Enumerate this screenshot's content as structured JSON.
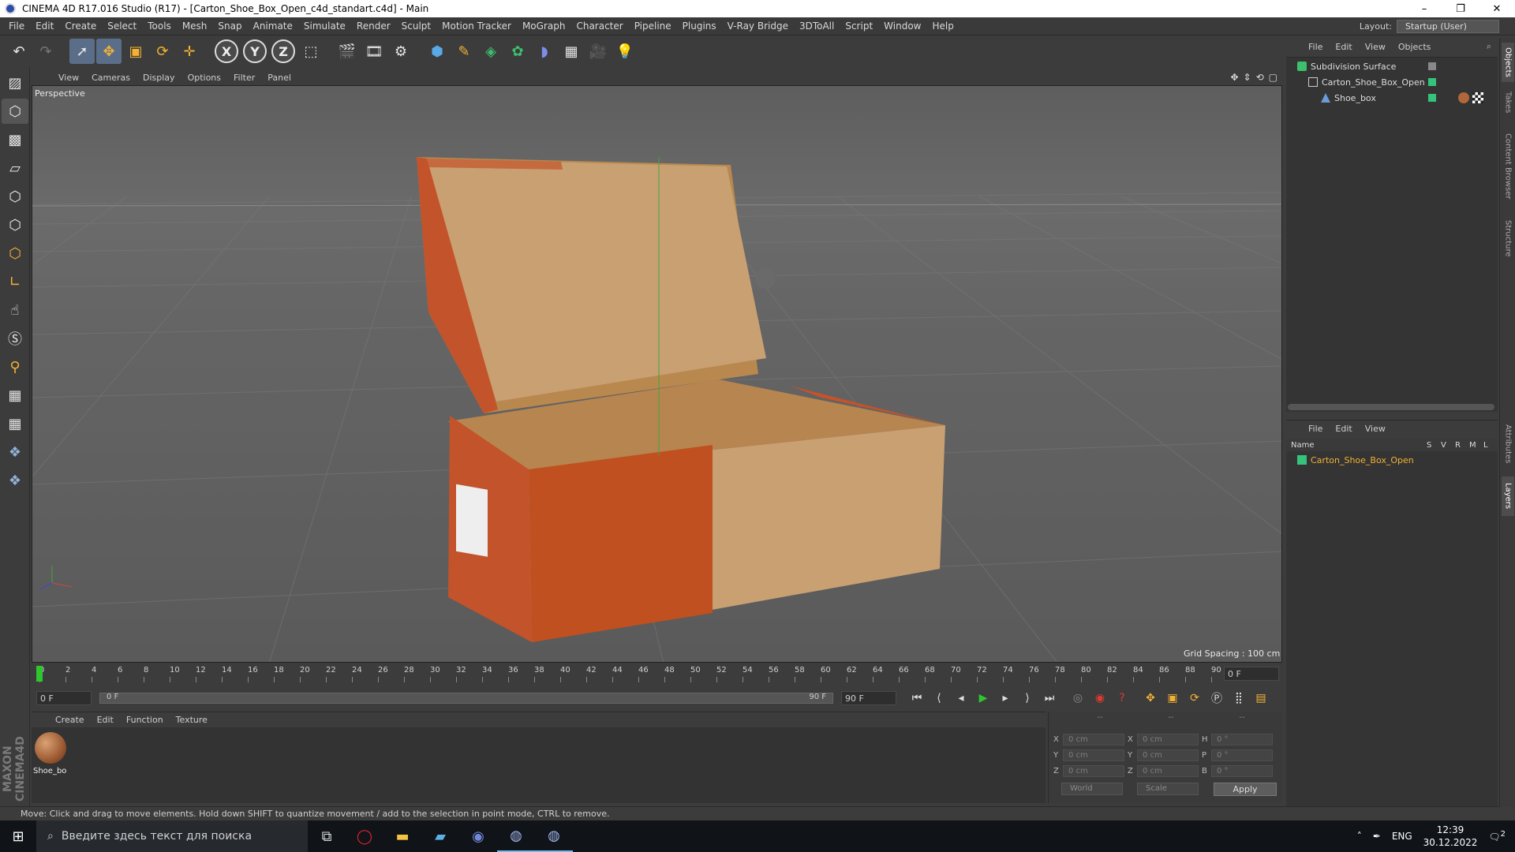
{
  "window": {
    "title": "CINEMA 4D R17.016 Studio (R17) - [Carton_Shoe_Box_Open_c4d_standart.c4d] - Main",
    "controls": [
      "–",
      "❐",
      "✕"
    ]
  },
  "menubar": {
    "items": [
      "File",
      "Edit",
      "Create",
      "Select",
      "Tools",
      "Mesh",
      "Snap",
      "Animate",
      "Simulate",
      "Render",
      "Sculpt",
      "Motion Tracker",
      "MoGraph",
      "Character",
      "Pipeline",
      "Plugins",
      "V-Ray Bridge",
      "3DToAll",
      "Script",
      "Window",
      "Help"
    ],
    "layout_label": "Layout:",
    "layout_value": "Startup (User)"
  },
  "toolbar": {
    "axis_labels": [
      "X",
      "Y",
      "Z"
    ]
  },
  "viewport": {
    "menu": [
      "View",
      "Cameras",
      "Display",
      "Options",
      "Filter",
      "Panel"
    ],
    "label": "Perspective",
    "grid_spacing": "Grid Spacing : 100 cm"
  },
  "timeline": {
    "ticks": [
      "0",
      "2",
      "4",
      "6",
      "8",
      "10",
      "12",
      "14",
      "16",
      "18",
      "20",
      "22",
      "24",
      "26",
      "28",
      "30",
      "32",
      "34",
      "36",
      "38",
      "40",
      "42",
      "44",
      "46",
      "48",
      "50",
      "52",
      "54",
      "56",
      "58",
      "60",
      "62",
      "64",
      "66",
      "68",
      "70",
      "72",
      "74",
      "76",
      "78",
      "80",
      "82",
      "84",
      "86",
      "88",
      "90"
    ],
    "current_frame": "0 F"
  },
  "frame_controls": {
    "start": "0 F",
    "range_start": "0 F",
    "range_end": "90 F",
    "end": "90 F"
  },
  "material_manager": {
    "menu": [
      "Create",
      "Edit",
      "Function",
      "Texture"
    ],
    "material_name": "Shoe_bo"
  },
  "coordinates": {
    "header": [
      "--",
      "--",
      "--"
    ],
    "rows": [
      {
        "a": "X",
        "av": "0 cm",
        "b": "X",
        "bv": "0 cm",
        "c": "H",
        "cv": "0 °"
      },
      {
        "a": "Y",
        "av": "0 cm",
        "b": "Y",
        "bv": "0 cm",
        "c": "P",
        "cv": "0 °"
      },
      {
        "a": "Z",
        "av": "0 cm",
        "b": "Z",
        "bv": "0 cm",
        "c": "B",
        "cv": "0 °"
      }
    ],
    "mode1": "World",
    "mode2": "Scale",
    "apply": "Apply"
  },
  "statusbar": {
    "text": "Move: Click and drag to move elements. Hold down SHIFT to quantize movement / add to the selection in point mode, CTRL to remove."
  },
  "object_manager": {
    "menu": [
      "File",
      "Edit",
      "View",
      "Objects"
    ],
    "objects": [
      "Subdivision Surface",
      "Carton_Shoe_Box_Open",
      "Shoe_box"
    ]
  },
  "layer_manager": {
    "menu": [
      "File",
      "Edit",
      "View"
    ],
    "columns": [
      "Name",
      "S",
      "V",
      "R",
      "M",
      "L"
    ],
    "layers": [
      "Carton_Shoe_Box_Open"
    ]
  },
  "right_tabs": [
    "Objects",
    "Takes",
    "Content Browser",
    "Structure",
    "Attributes",
    "Layers"
  ],
  "taskbar": {
    "search_placeholder": "Введите здесь текст для поиска",
    "lang": "ENG",
    "time": "12:39",
    "date": "30.12.2022",
    "notifications": "2"
  },
  "colors": {
    "accent_green": "#2ec52e",
    "layer_green": "#35c27b",
    "box_orange": "#c3532a",
    "box_cardboard": "#c9a072"
  }
}
